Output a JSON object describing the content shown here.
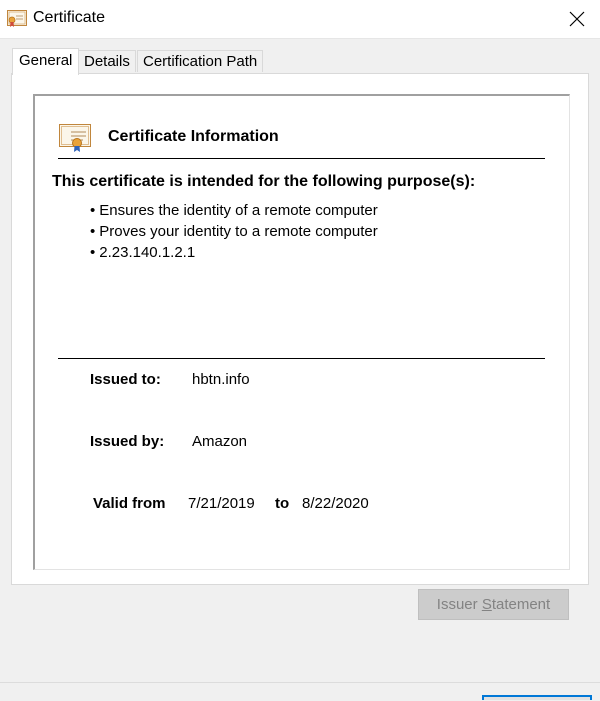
{
  "window": {
    "title": "Certificate",
    "title_icon": "certificate-icon",
    "close_icon": "close-icon"
  },
  "tabs": [
    {
      "label": "General",
      "active": true
    },
    {
      "label": "Details",
      "active": false
    },
    {
      "label": "Certification Path",
      "active": false
    }
  ],
  "certificate_info": {
    "title": "Certificate Information",
    "icon": "certificate-icon",
    "purpose_heading": "This certificate is intended for the following purpose(s):",
    "purposes": [
      "Ensures the identity of a remote computer",
      "Proves your identity to a remote computer",
      "2.23.140.1.2.1"
    ]
  },
  "details": {
    "issued_to_label": "Issued to:",
    "issued_to_value": "hbtn.info",
    "issued_by_label": "Issued by:",
    "issued_by_value": "Amazon",
    "valid_from_label": "Valid from",
    "valid_from_value": "7/21/2019",
    "to_label": "to",
    "valid_to_value": "8/22/2020"
  },
  "buttons": {
    "issuer_statement_pre": "Issuer ",
    "issuer_statement_accel": "S",
    "issuer_statement_post": "tatement"
  },
  "colors": {
    "window_bg": "#f0f0f0",
    "panel_bg": "#ffffff",
    "disabled_button_bg": "#cccccc",
    "disabled_text": "#838383",
    "focus_blue": "#0078d7"
  }
}
